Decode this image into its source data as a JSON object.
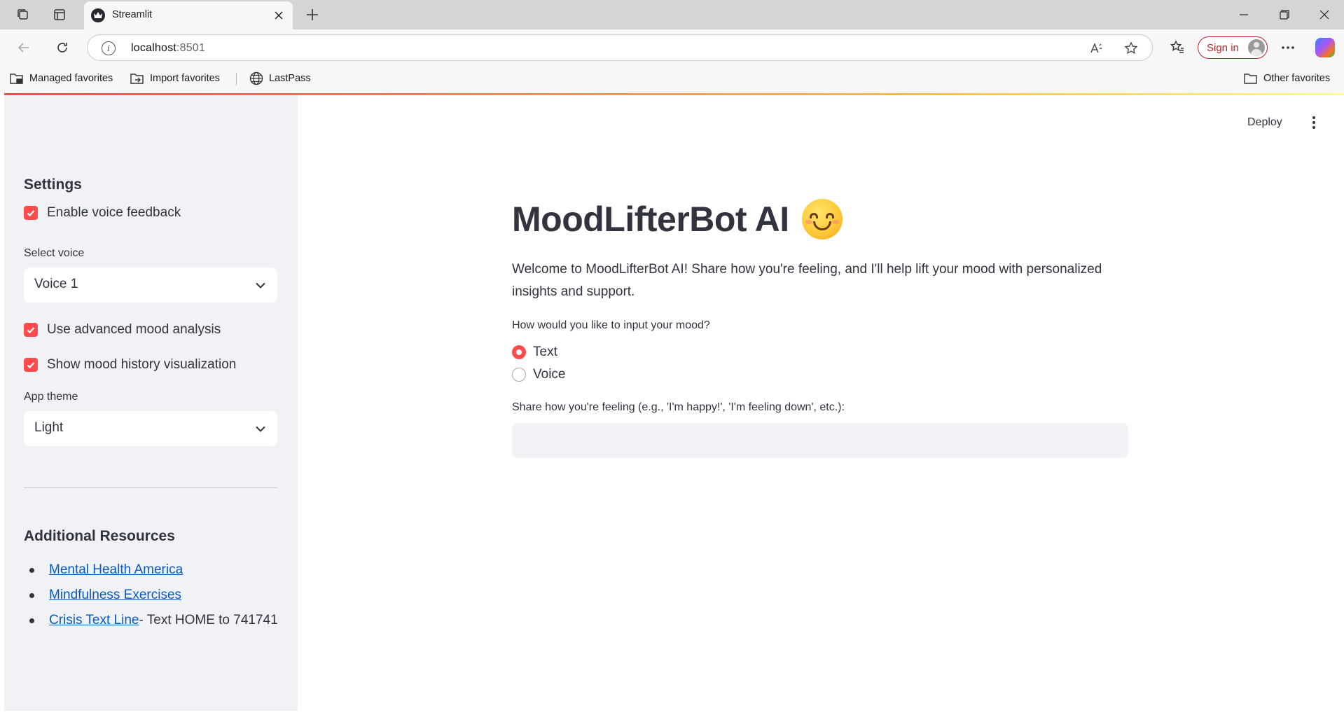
{
  "browser": {
    "tab_title": "Streamlit",
    "url_host": "localhost",
    "url_port": ":8501",
    "signin_label": "Sign in",
    "favorites": [
      "Managed favorites",
      "Import favorites",
      "LastPass"
    ],
    "other_favorites": "Other favorites"
  },
  "sidebar": {
    "settings_heading": "Settings",
    "enable_voice_label": "Enable voice feedback",
    "enable_voice_checked": true,
    "select_voice_label": "Select voice",
    "select_voice_value": "Voice 1",
    "advanced_mood_label": "Use advanced mood analysis",
    "advanced_mood_checked": true,
    "mood_history_label": "Show mood history visualization",
    "mood_history_checked": true,
    "app_theme_label": "App theme",
    "app_theme_value": "Light",
    "resources_heading": "Additional Resources",
    "resources": [
      {
        "link": "Mental Health America",
        "suffix": ""
      },
      {
        "link": "Mindfulness Exercises",
        "suffix": ""
      },
      {
        "link": "Crisis Text Line",
        "suffix": " - Text HOME to 741741"
      }
    ]
  },
  "main": {
    "deploy_label": "Deploy",
    "title": "MoodLifterBot AI",
    "title_emoji": "smiling-face-emoji",
    "intro": "Welcome to MoodLifterBot AI! Share how you're feeling, and I'll help lift your mood with personalized insights and support.",
    "input_question": "How would you like to input your mood?",
    "input_options": [
      "Text",
      "Voice"
    ],
    "input_selected": "Text",
    "share_label": "Share how you're feeling (e.g., 'I'm happy!', 'I'm feeling down', etc.):",
    "share_value": ""
  },
  "colors": {
    "accent": "#ff4b4b",
    "sidebar_bg": "#f0f2f6",
    "text": "#31333f",
    "link": "#0a58ca"
  }
}
